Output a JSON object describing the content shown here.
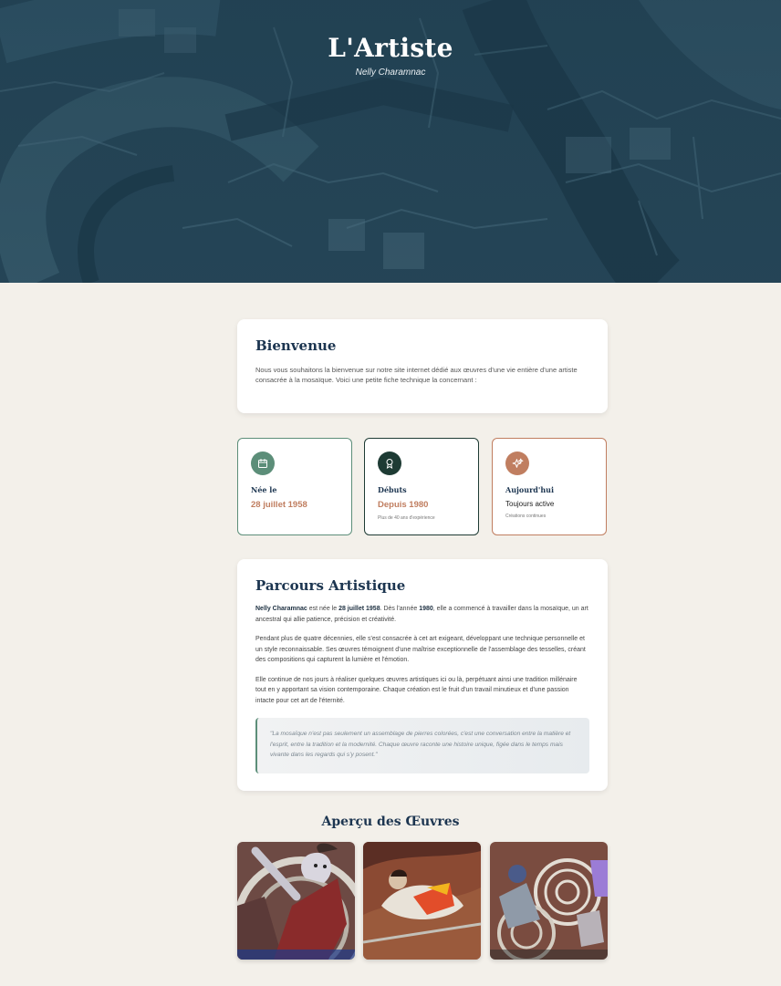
{
  "hero": {
    "title": "L'Artiste",
    "subtitle": "Nelly Charamnac"
  },
  "welcome": {
    "heading": "Bienvenue",
    "text": "Nous vous souhaitons la bienvenue sur notre site internet dédié aux œuvres d'une vie entière d'une artiste consacrée à la mosaïque. Voici une petite fiche technique la concernant :"
  },
  "facts": [
    {
      "icon": "calendar-icon",
      "label": "Née le",
      "value": "28 juillet 1958",
      "note": ""
    },
    {
      "icon": "award-icon",
      "label": "Débuts",
      "value": "Depuis 1980",
      "note": "Plus de 40 ans d'expérience"
    },
    {
      "icon": "sparkles-icon",
      "label": "Aujourd'hui",
      "value": "Toujours active",
      "note": "Créations continues"
    }
  ],
  "parcours": {
    "heading": "Parcours Artistique",
    "p1": {
      "name": "Nelly Charamnac",
      "t1": " est née le ",
      "date": "28 juillet 1958",
      "t2": ". Dès l'année ",
      "year": "1980",
      "t3": ", elle a commencé à travailler dans la mosaïque, un art ancestral qui allie patience, précision et créativité."
    },
    "p2": "Pendant plus de quatre décennies, elle s'est consacrée à cet art exigeant, développant une technique personnelle et un style reconnaissable. Ses œuvres témoignent d'une maîtrise exceptionnelle de l'assemblage des tesselles, créant des compositions qui capturent la lumière et l'émotion.",
    "p3": "Elle continue de nos jours à réaliser quelques œuvres artistiques ici ou là, perpétuant ainsi une tradition millénaire tout en y apportant sa vision contemporaine. Chaque création est le fruit d'un travail minutieux et d'une passion intacte pour cet art de l'éternité.",
    "quote": "\"La mosaïque n'est pas seulement un assemblage de pierres colorées, c'est une conversation entre la matière et l'esprit, entre la tradition et la modernité. Chaque œuvre raconte une histoire unique, figée dans le temps mais vivante dans les regards qui s'y posent.\""
  },
  "gallery": {
    "heading": "Aperçu des Œuvres",
    "items": [
      "mosaic-artwork-1",
      "mosaic-artwork-2",
      "mosaic-artwork-3"
    ]
  },
  "colors": {
    "navy": "#1c3550",
    "green": "#5c8e79",
    "dark_green": "#1e3b34",
    "terracotta": "#c07e60",
    "background": "#f3f0ea"
  }
}
